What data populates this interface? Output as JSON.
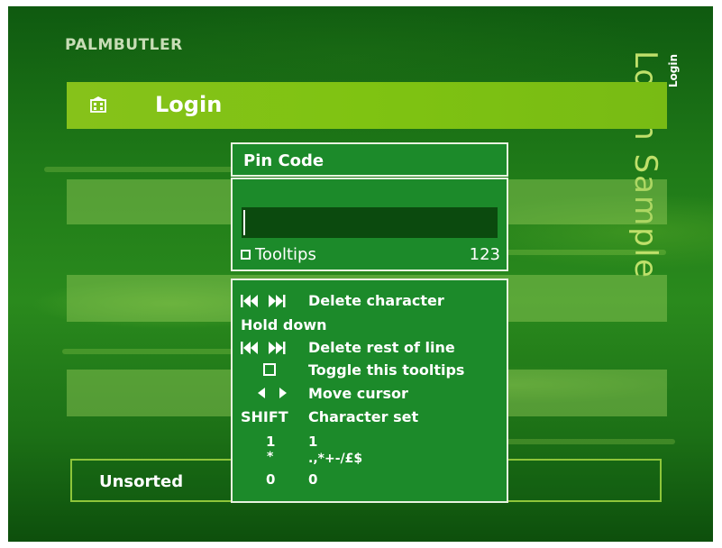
{
  "brand": {
    "logo": "PALMBUTLER"
  },
  "side": {
    "title": "Login Sample",
    "small_label": "Login"
  },
  "header": {
    "icon": "building-icon",
    "label": "Login"
  },
  "list": {
    "unsorted_label": "Unsorted"
  },
  "dialog": {
    "title": "Pin Code",
    "input_value": "",
    "tooltips_label": "Tooltips",
    "charset_indicator": "123"
  },
  "help": {
    "lines": [
      {
        "keys": "skip-back-forward-icons",
        "text": "Delete character"
      },
      {
        "text": "Hold down"
      },
      {
        "keys": "skip-back-forward-icons",
        "text": "Delete rest of line"
      },
      {
        "keys": "square-button-icon",
        "text": "Toggle this tooltips"
      },
      {
        "keys": "left-right-arrow-icons",
        "text": "Move cursor"
      },
      {
        "key_text": "SHIFT",
        "text": "Character set"
      },
      {
        "key_text": "1",
        "text": "1"
      },
      {
        "key_text": "*",
        "text": ".,*+-/£$"
      },
      {
        "key_text": "0",
        "text": "0"
      }
    ]
  },
  "colors": {
    "highlight": "#7fc312",
    "dialog_bg": "#1c8a2a",
    "input_bg": "#0b4a0e",
    "side_title": "#bfe06a"
  }
}
